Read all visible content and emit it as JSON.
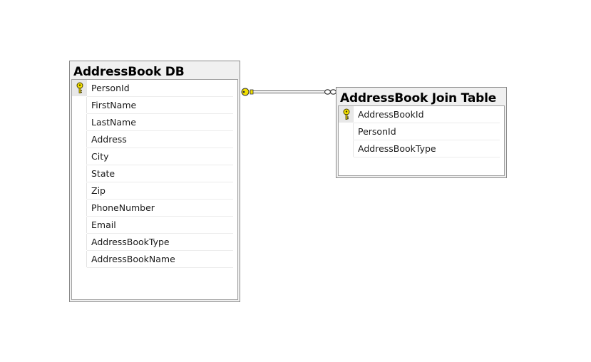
{
  "diagram": {
    "tables": [
      {
        "title": "AddressBook DB",
        "columns": [
          {
            "name": "PersonId",
            "primary_key": true
          },
          {
            "name": "FirstName",
            "primary_key": false
          },
          {
            "name": "LastName",
            "primary_key": false
          },
          {
            "name": "Address",
            "primary_key": false
          },
          {
            "name": "City",
            "primary_key": false
          },
          {
            "name": "State",
            "primary_key": false
          },
          {
            "name": "Zip",
            "primary_key": false
          },
          {
            "name": "PhoneNumber",
            "primary_key": false
          },
          {
            "name": "Email",
            "primary_key": false
          },
          {
            "name": "AddressBookType",
            "primary_key": false
          },
          {
            "name": "AddressBookName",
            "primary_key": false
          }
        ]
      },
      {
        "title": "AddressBook Join Table",
        "columns": [
          {
            "name": "AddressBookId",
            "primary_key": true
          },
          {
            "name": "PersonId",
            "primary_key": false
          },
          {
            "name": "AddressBookType",
            "primary_key": false
          }
        ]
      }
    ],
    "relationships": [
      {
        "from_table": "AddressBook DB",
        "from_end": "one-key",
        "to_table": "AddressBook Join Table",
        "to_end": "many-infinity"
      }
    ],
    "colors": {
      "key_icon": "#f2e000",
      "table_frame": "#f0f0f0",
      "connector": "#4a4a4a"
    }
  }
}
